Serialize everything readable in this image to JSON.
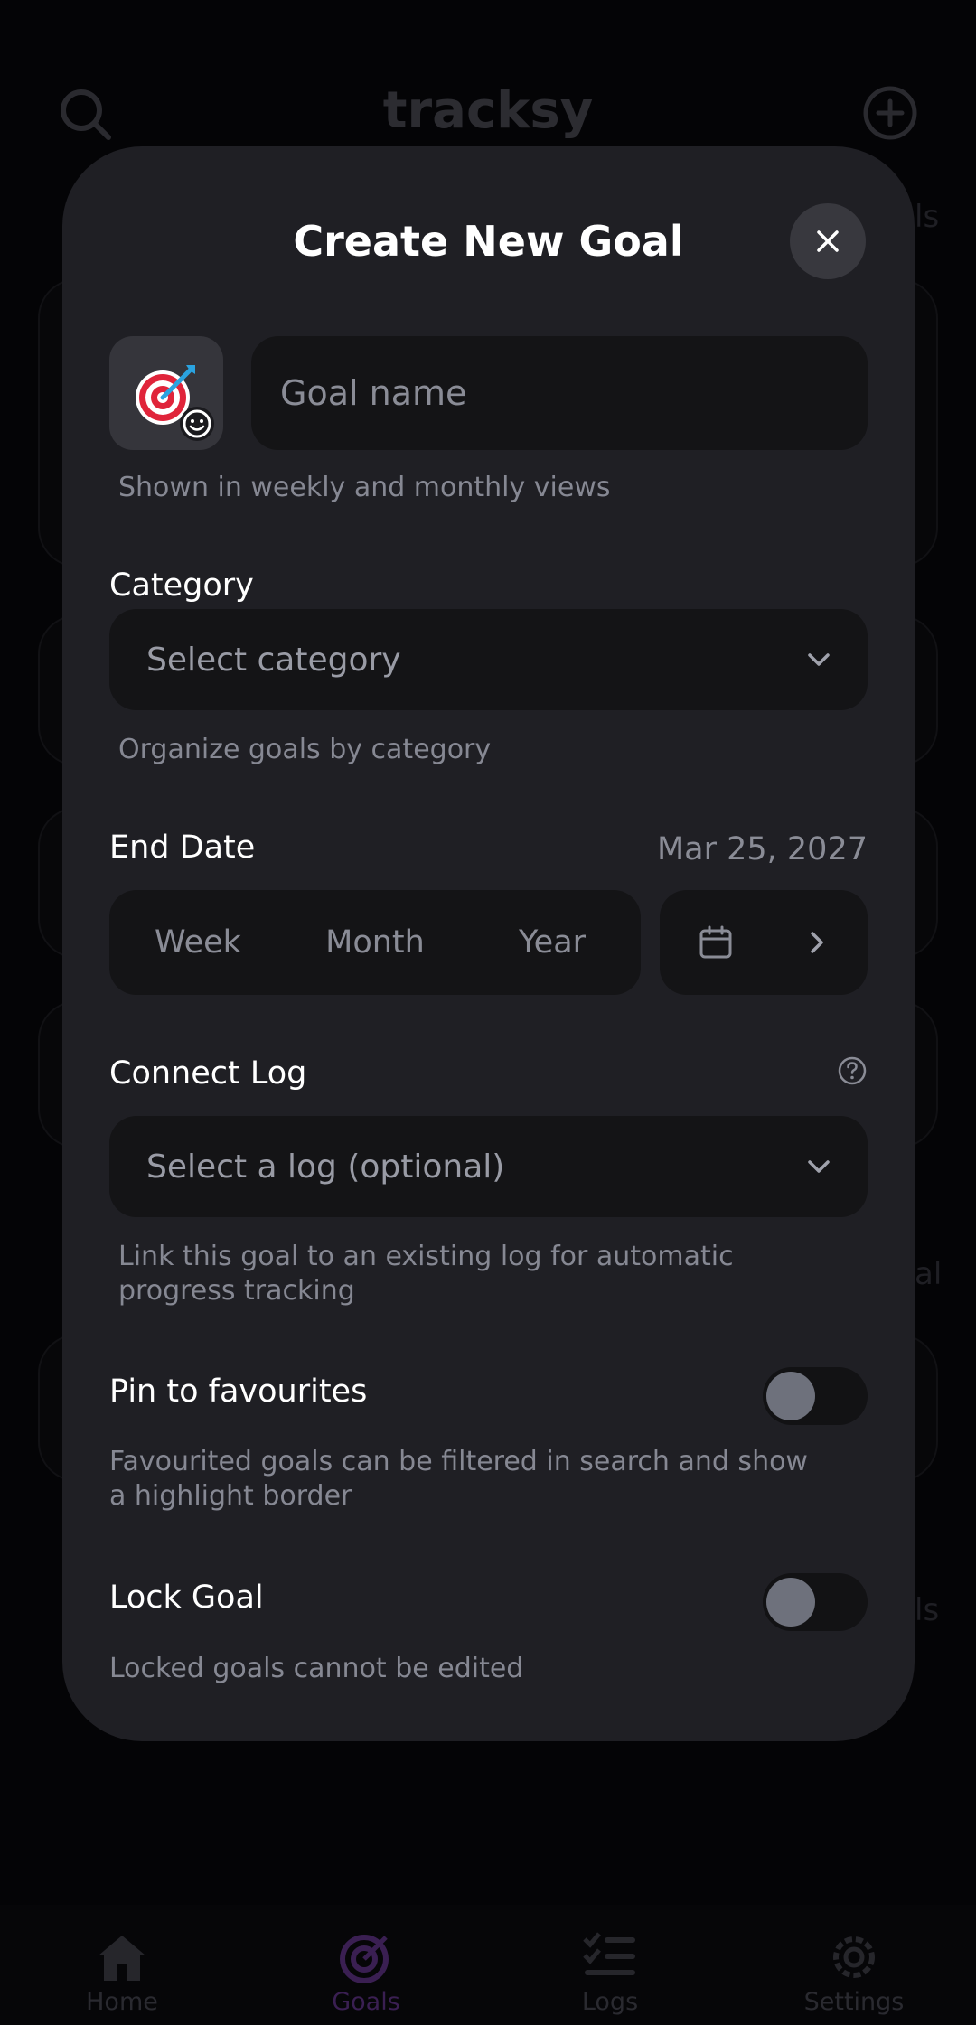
{
  "app": {
    "name": "tracksy"
  },
  "background": {
    "side_texts": [
      "ls",
      "al",
      "ls"
    ]
  },
  "nav": {
    "items": [
      {
        "label": "Home",
        "icon": "home-icon"
      },
      {
        "label": "Goals",
        "icon": "target-icon",
        "active": true
      },
      {
        "label": "Logs",
        "icon": "checklist-icon"
      },
      {
        "label": "Settings",
        "icon": "gear-icon"
      }
    ]
  },
  "modal": {
    "title": "Create New Goal",
    "close_icon": "close-icon",
    "emoji": "target-arrow-emoji",
    "goal_name": {
      "placeholder": "Goal name",
      "helper": "Shown in weekly and monthly views"
    },
    "category": {
      "label": "Category",
      "placeholder": "Select category",
      "helper": "Organize goals by category"
    },
    "end_date": {
      "label": "End Date",
      "value": "Mar 25, 2027",
      "segments": [
        "Week",
        "Month",
        "Year"
      ]
    },
    "connect_log": {
      "label": "Connect Log",
      "placeholder": "Select a log (optional)",
      "helper": "Link this goal to an existing log for automatic progress tracking"
    },
    "pin": {
      "label": "Pin to favourites",
      "helper": "Favourited goals can be filtered in search and show a highlight border",
      "enabled": false
    },
    "lock": {
      "label": "Lock Goal",
      "helper": "Locked goals cannot be edited",
      "enabled": false
    }
  },
  "colors": {
    "background": "#040406",
    "modal": "#1f1f24",
    "input": "#141416",
    "accent_active": "#3a1f52",
    "text_muted": "#868893"
  }
}
